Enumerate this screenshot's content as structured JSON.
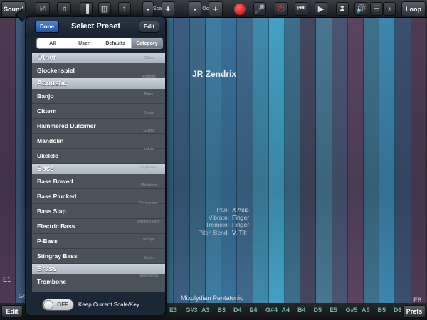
{
  "toolbar": {
    "sound_label": "Sound",
    "flat_sharp_label": "♭♮",
    "scale_minus_label": "-",
    "scale_label": "Scale",
    "scale_plus_label": "+",
    "octave_minus_label": "-",
    "octave_label": "Oct",
    "octave_plus_label": "+",
    "loop_label": "Loop",
    "one_label": "1"
  },
  "bottombar": {
    "edit_label": "Edit",
    "prefs_label": "Prefs",
    "notes": [
      "E3",
      "G#3",
      "A3",
      "B3",
      "D4",
      "E4",
      "G#4",
      "A4",
      "B4",
      "D5",
      "E5",
      "G#5",
      "A5",
      "B5",
      "D6"
    ]
  },
  "main": {
    "preset_name": "JR Zendrix",
    "scale_name": "Mixolydian Pentatonic",
    "low_note": "E1",
    "high_note": "E6",
    "partial_note": "G#",
    "mapping": [
      {
        "key": "Pan:",
        "value": "X Axis"
      },
      {
        "key": "Vibrato:",
        "value": "Finger"
      },
      {
        "key": "Tremolo:",
        "value": "Finger"
      },
      {
        "key": "Pitch Bend:",
        "value": "V. Tilt"
      }
    ],
    "column_colors": [
      "#4e3850",
      "#3e5a78",
      "#3e6f90",
      "#43335a",
      "#3d4666",
      "#3c4f6e",
      "#3f6585",
      "#447ca0",
      "#2f6f84",
      "#2f4f7a",
      "#336c86",
      "#3d5d80",
      "#3d6a88",
      "#3e7ea2",
      "#3a709a",
      "#40698c",
      "#3f8aac",
      "#43a0c4",
      "#3d6e8a",
      "#43485e",
      "#487690",
      "#4a5571",
      "#5a445e",
      "#3e708a",
      "#3b86b0",
      "#3b4f6e",
      "#4f3a54"
    ]
  },
  "popover": {
    "title": "Select Preset",
    "done_label": "Done",
    "edit_label": "Edit",
    "segments": [
      "All",
      "User",
      "Defaults",
      "Category"
    ],
    "selected_segment": "Category",
    "list": [
      {
        "type": "header",
        "label": "Other"
      },
      {
        "type": "item",
        "label": "Glockenspiel"
      },
      {
        "type": "header",
        "label": "Acoustic"
      },
      {
        "type": "item",
        "label": "Banjo"
      },
      {
        "type": "item",
        "label": "Cittern"
      },
      {
        "type": "item",
        "label": "Hammered Dulcimer"
      },
      {
        "type": "item",
        "label": "Mandolin"
      },
      {
        "type": "item",
        "label": "Ukelele"
      },
      {
        "type": "header",
        "label": "Bass"
      },
      {
        "type": "item",
        "label": "Bass Bowed"
      },
      {
        "type": "item",
        "label": "Bass Plucked"
      },
      {
        "type": "item",
        "label": "Bass Slap"
      },
      {
        "type": "item",
        "label": "Electric Bass"
      },
      {
        "type": "item",
        "label": "P-Bass"
      },
      {
        "type": "item",
        "label": "Stingray Bass"
      },
      {
        "type": "header",
        "label": "Brass"
      },
      {
        "type": "item",
        "label": "Trombone"
      }
    ],
    "index": [
      "Other",
      "Acoustic",
      "Bass",
      "Brass",
      "Guitar",
      "Indian",
      "Keyboard",
      "Mellotron",
      "Percussion",
      "Pitched Perc",
      "Strings",
      "Synth",
      "Woodwind"
    ],
    "toggle_state": "OFF",
    "toggle_text": "Keep Current Scale/Key"
  }
}
